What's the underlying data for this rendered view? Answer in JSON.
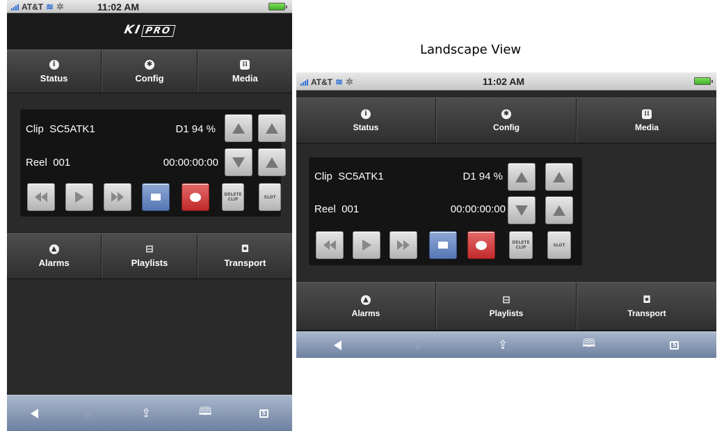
{
  "caption": "Landscape View",
  "statusbar": {
    "carrier": "AT&T",
    "time": "11:02 AM"
  },
  "brand": {
    "logo_main": "KI",
    "logo_box": "PRO"
  },
  "tabs_top": [
    {
      "label": "Status",
      "icon": "i"
    },
    {
      "label": "Config",
      "icon": "✱"
    },
    {
      "label": "Media",
      "icon": "⁞⁞"
    }
  ],
  "panel": {
    "clip_label": "Clip",
    "clip_name": "SC5ATK1",
    "clip_status": "D1 94 %",
    "reel_label": "Reel",
    "reel_number": "001",
    "timecode": "00:00:00:00",
    "delete_clip_label": "DELETE CLIP",
    "slot_label": "SLOT"
  },
  "tabs_bottom": [
    {
      "label": "Alarms",
      "icon": "▲"
    },
    {
      "label": "Playlists",
      "icon": "⊟"
    },
    {
      "label": "Transport",
      "icon": "◘"
    }
  ],
  "safari": {
    "pages_count": "5"
  }
}
